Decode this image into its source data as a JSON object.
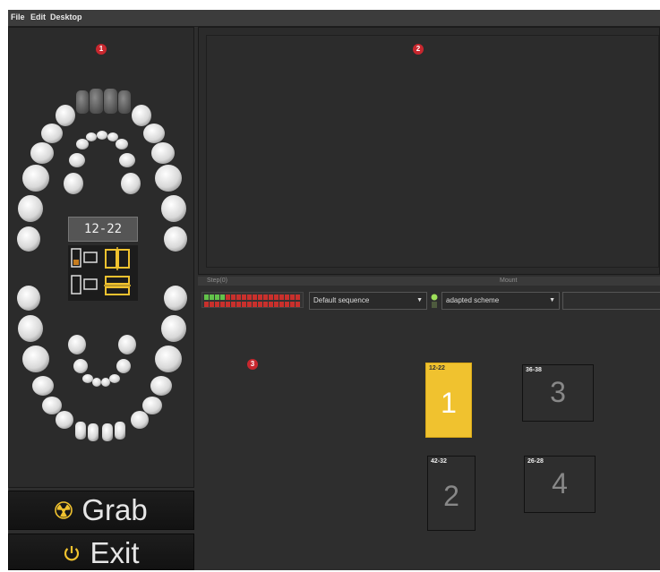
{
  "menu": {
    "file": "File",
    "edit": "Edit",
    "desktop": "Desktop"
  },
  "markers": [
    "1",
    "2",
    "3"
  ],
  "chart": {
    "tooth_range": "12-22"
  },
  "strip": {
    "left_label": "Step(0)",
    "right_label": "Mount"
  },
  "toolbar": {
    "sequence_value": "Default sequence",
    "scheme_value": "adapted scheme"
  },
  "cards": [
    {
      "range": "12-22",
      "number": "1",
      "selected": true
    },
    {
      "range": "36-38",
      "number": "3",
      "selected": false
    },
    {
      "range": "42-32",
      "number": "2",
      "selected": false
    },
    {
      "range": "26-28",
      "number": "4",
      "selected": false
    }
  ],
  "buttons": {
    "grab_label": "Grab",
    "exit_label": "Exit"
  },
  "colors": {
    "accent": "#f0c22f",
    "marker": "#c8272e",
    "background": "#2e2e2e"
  },
  "icons": {
    "grab": "radiation-icon",
    "exit": "power-icon"
  }
}
